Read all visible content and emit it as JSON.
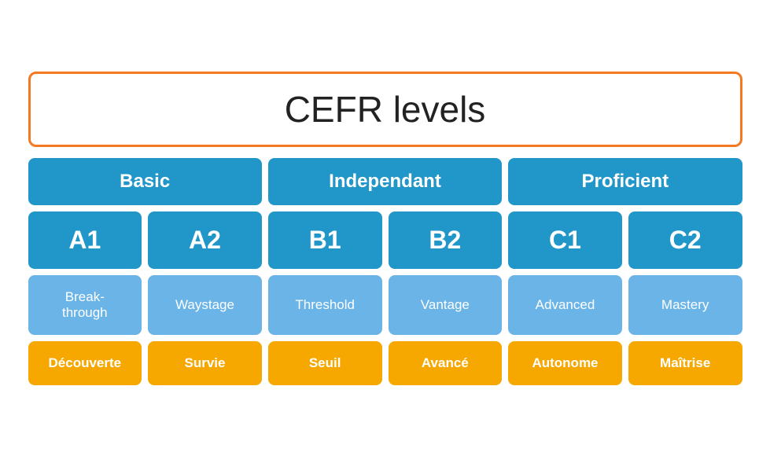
{
  "title": "CEFR levels",
  "groups": [
    {
      "label": "Basic"
    },
    {
      "label": "Independant"
    },
    {
      "label": "Proficient"
    }
  ],
  "levels": [
    {
      "code": "A1",
      "english": "Break-\nthrough",
      "french": "Découverte"
    },
    {
      "code": "A2",
      "english": "Waystage",
      "french": "Survie"
    },
    {
      "code": "B1",
      "english": "Threshold",
      "french": "Seuil"
    },
    {
      "code": "B2",
      "english": "Vantage",
      "french": "Avancé"
    },
    {
      "code": "C1",
      "english": "Advanced",
      "french": "Autonome"
    },
    {
      "code": "C2",
      "english": "Mastery",
      "french": "Maîtrise"
    }
  ]
}
